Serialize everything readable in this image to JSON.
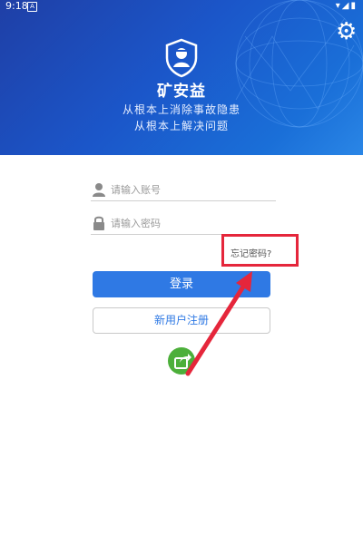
{
  "status_bar": {
    "time": "9:18",
    "app_badge": "A"
  },
  "header": {
    "brand": "矿安益",
    "slogan_line1": "从根本上消除事故隐患",
    "slogan_line2": "从根本上解决问题"
  },
  "form": {
    "account_placeholder": "请输入账号",
    "password_placeholder": "请输入密码",
    "forgot_label": "忘记密码?",
    "login_label": "登录",
    "register_label": "新用户注册"
  },
  "icons": [
    "gear-icon",
    "user-icon",
    "lock-icon",
    "share-icon",
    "wifi-icon",
    "signal-icon",
    "battery-icon"
  ],
  "colors": {
    "primary": "#2f79e4",
    "hero": "#1b56c9",
    "annotation": "#e5263b",
    "share": "#4caf3a"
  }
}
